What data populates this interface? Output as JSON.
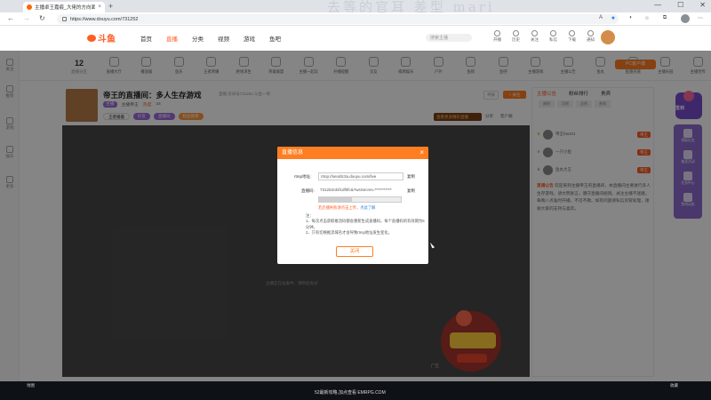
{
  "browser": {
    "tab_title": "主播卓王嘉痕_大佬的方向面痕_斗...",
    "url": "https://www.douyu.com/731252",
    "watermark": "去等的官耳 差型 mari"
  },
  "site": {
    "logo_text": "斗鱼",
    "nav": [
      "首页",
      "直播",
      "分类",
      "视频",
      "游戏",
      "鱼吧"
    ],
    "search_placeholder": "搜索主播",
    "header_icons": [
      "开播",
      "历史",
      "关注",
      "私信",
      "下载",
      "通知"
    ]
  },
  "category_bar": {
    "count": "12",
    "count_label": "直播分区",
    "items": [
      "直播大厅",
      "播放器",
      "鱼乐",
      "王者荣耀",
      "绝地求生",
      "英雄联盟",
      "主播一起玩",
      "开播提醒",
      "交友",
      "棋牌娱乐",
      "户外",
      "鱼购",
      "鱼吧",
      "主播游戏",
      "主播公告",
      "鱼丸",
      "鱼翅充值",
      "主播乐园",
      "主播宣传"
    ],
    "pc_button": "PC客户端"
  },
  "left_sidebar": [
    "关注",
    "推荐",
    "游戏",
    "娱乐",
    "更多"
  ],
  "room": {
    "title": "帝王的直播间：多人生存游戏",
    "tags": "直播  房间号731252  斗鱼一哥",
    "level": "主播",
    "host": "主播帝王",
    "hot_label": "热度",
    "hot_value": "34",
    "badges": [
      "王者播酱",
      "好友",
      "直播间",
      "粉丝勋章"
    ],
    "follow": "+ 关注",
    "report": "举报",
    "bottom_alt": "查看更多精彩直播",
    "share_items": [
      "分享",
      "客户端"
    ]
  },
  "player": {
    "status": "主播正在准备中，请稍后再试",
    "ad_tag": "广告"
  },
  "chat": {
    "tabs": [
      "主播公告",
      "粉丝排行",
      "贵宾"
    ],
    "rank_tabs": [
      "周榜",
      "月榜",
      "总榜",
      "贵宾"
    ],
    "rows": [
      {
        "name": "帝王fans01",
        "tag": "帝王"
      },
      {
        "name": "一只小鱼",
        "tag": "帝王"
      },
      {
        "name": "鱼丸大王",
        "tag": "帝王"
      }
    ],
    "notice_head": "直播公告",
    "notice_body": "欢迎来到主播帝王的直播间，本直播间主要进行多人生存游戏，请文明发言，遵守直播间规则。关注主播不迷路，每晚八点准时开播，不见不散。如有问题请私信房管处理，谢谢大家的支持与喜欢。"
  },
  "right_float": {
    "title": "签到",
    "items": [
      "领取礼包",
      "抽奖活动",
      "任务中心",
      "鱼吧动态"
    ]
  },
  "modal": {
    "title": "直播信息",
    "rtmp_label": "rtmp地址:",
    "rtmp_value": "rtmp://sendtc3a.douyu.com/live",
    "rtmp_copy": "复制",
    "code_label": "直播码:",
    "code_value": "731252rd4fcdf0fc&?wsSecret=***********",
    "code_copy": "复制",
    "warn": "若启播失败请点击上传，",
    "warn_link": "点此了解",
    "notes_head": "注：",
    "notes": [
      "1、每次点击获取推流码都会重新生成直播码，每个直播码的有效期为5分钟。",
      "2、只有切换推流域名才会导致rtmp地址发生变化。"
    ],
    "ok_button": "关闭"
  },
  "bottom_banner": {
    "center": "52最新攻略,加点查看 EMRPG.COM",
    "left": "地图",
    "right": "收藏"
  }
}
